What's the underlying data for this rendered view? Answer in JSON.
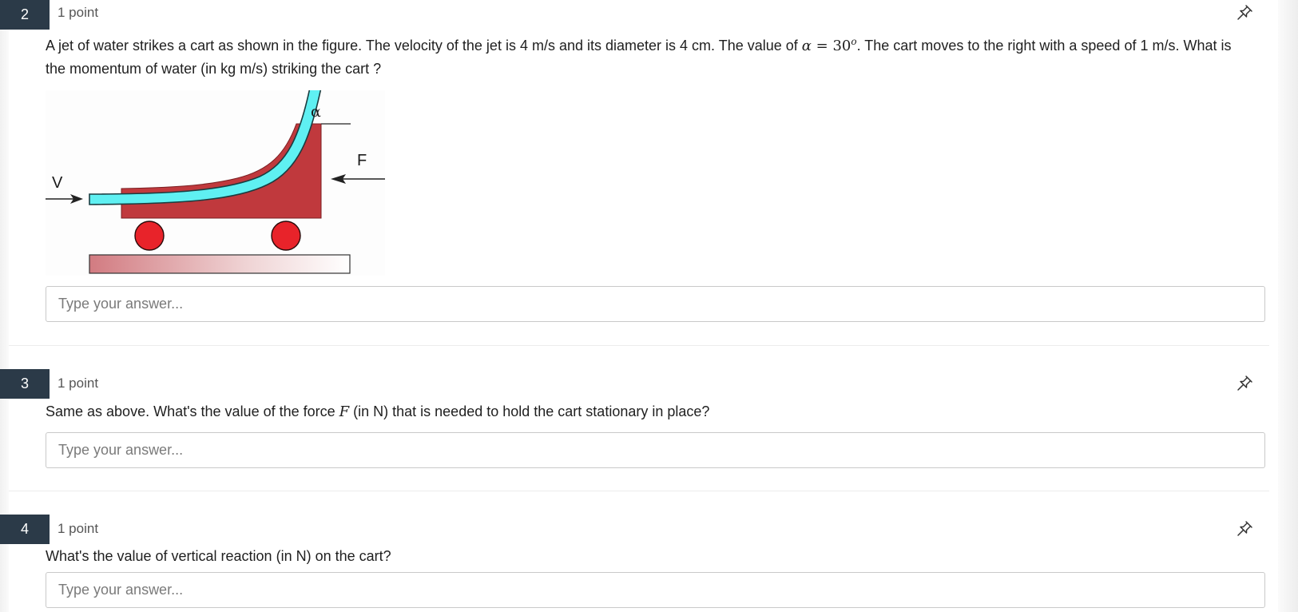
{
  "questions": [
    {
      "number": "2",
      "points": "1 point",
      "text": {
        "before_alpha": "A jet of water strikes a cart as shown in the figure. The velocity of the jet is 4 m/s and its diameter is 4 cm. The value of ",
        "alpha_symbol": "α",
        "equals": " = ",
        "alpha_value": "30",
        "alpha_sup": "o",
        "after_alpha": ". The cart moves to the right with a speed of 1 m/s. What is the momentum of water (in kg m/s) striking the cart ?"
      },
      "figure": {
        "label_alpha": "α",
        "label_F": "F",
        "label_V": "V"
      },
      "answer_placeholder": "Type your answer..."
    },
    {
      "number": "3",
      "points": "1 point",
      "text": {
        "before_F": "Same as above. What's the value of the force ",
        "F_symbol": "F",
        "after_F": " (in N) that is needed to hold the cart stationary in place?"
      },
      "answer_placeholder": "Type your answer..."
    },
    {
      "number": "4",
      "points": "1 point",
      "text": "What's the value of vertical reaction (in N) on the cart?",
      "answer_placeholder": "Type your answer..."
    }
  ],
  "icons": {
    "pin": "pin-icon"
  },
  "colors": {
    "number_badge": "#2b3a48",
    "cart": "#c0393d",
    "water_jet": "#5ff0f2",
    "wheel": "#e8232a"
  }
}
